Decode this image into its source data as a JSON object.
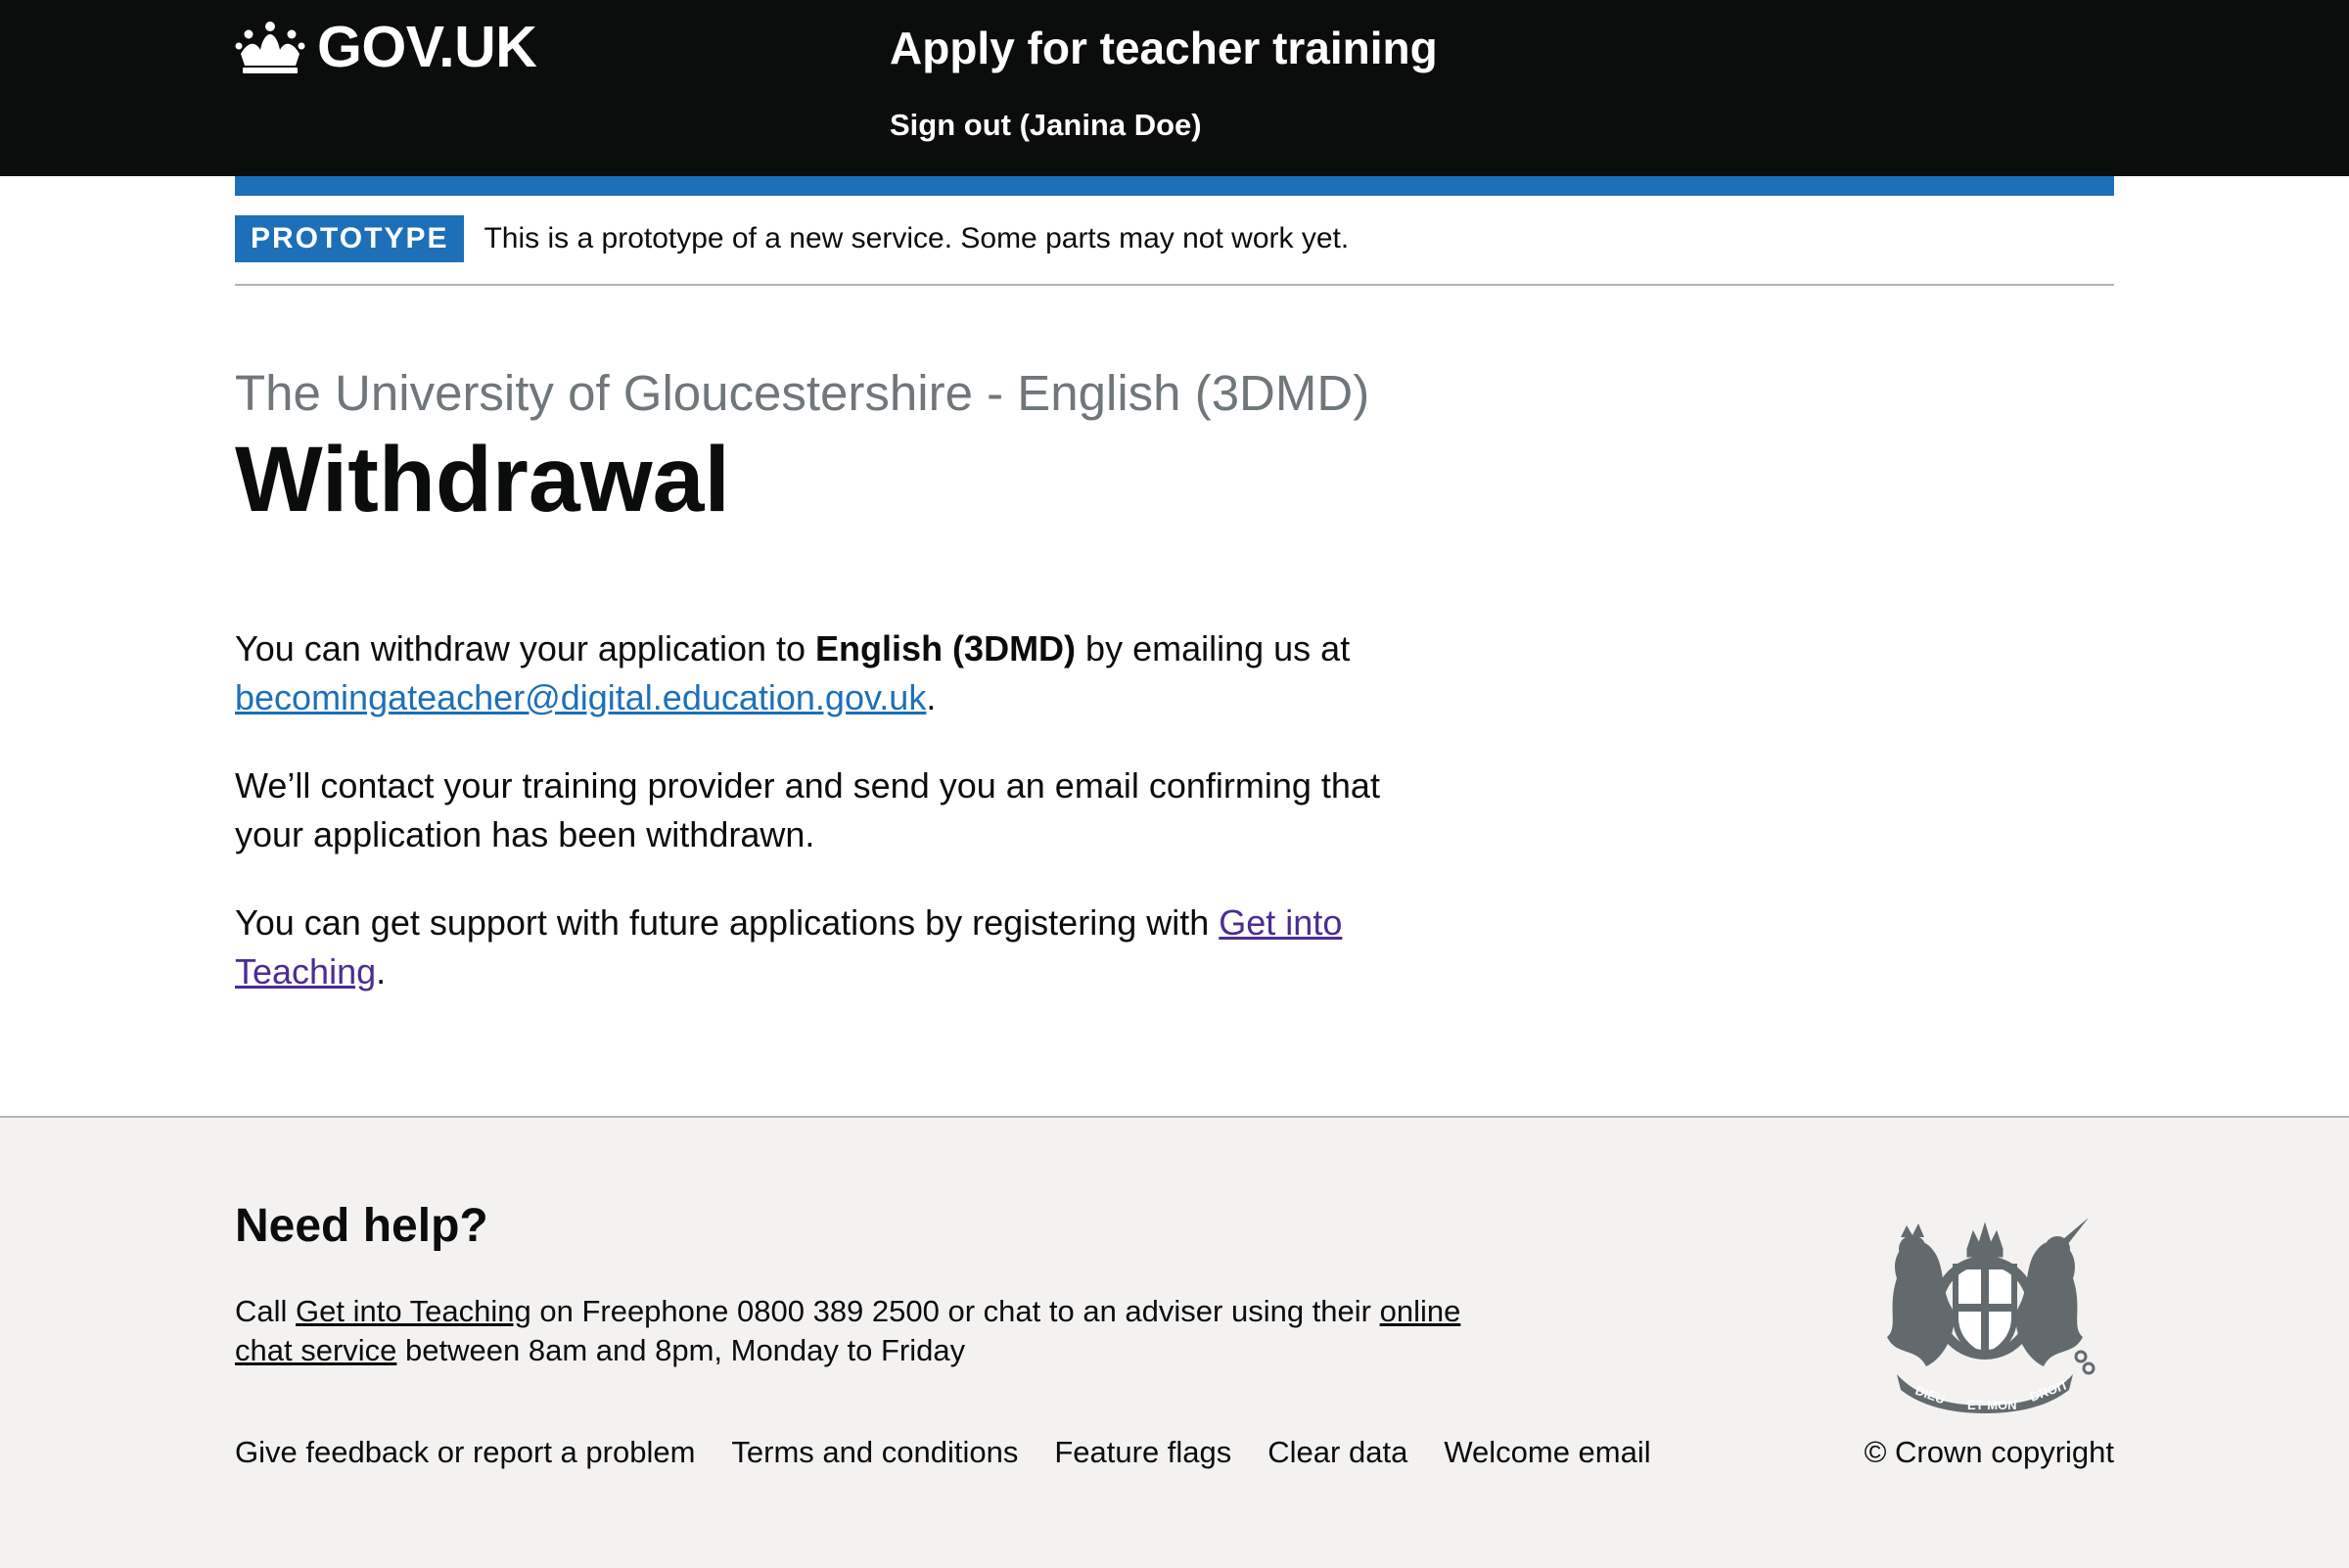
{
  "header": {
    "logo_text": "GOV.UK",
    "service_name": "Apply for teacher training",
    "sign_out": "Sign out (Janina Doe)"
  },
  "phase_banner": {
    "tag": "PROTOTYPE",
    "text": "This is a prototype of a new service. Some parts may not work yet."
  },
  "main": {
    "caption": "The University of Gloucestershire - English (3DMD)",
    "title": "Withdrawal",
    "p1_before": "You can withdraw your application to ",
    "p1_bold": "English (3DMD)",
    "p1_after": " by emailing us at ",
    "email": "becomingateacher@digital.education.gov.uk",
    "p1_end": ".",
    "p2": "We’ll contact your training provider and send you an email confirming that your application has been withdrawn.",
    "p3_before": "You can get support with future applications by registering with ",
    "p3_link": "Get into Teaching",
    "p3_end": "."
  },
  "footer": {
    "help_title": "Need help?",
    "help_call": "Call ",
    "help_link1": "Get into Teaching",
    "help_mid": " on Freephone 0800 389 2500 or chat to an adviser using their ",
    "help_link2": "online chat service",
    "help_end": " between 8am and 8pm, Monday to Friday",
    "links": [
      "Give feedback or report a problem",
      "Terms and conditions",
      "Feature flags",
      "Clear data",
      "Welcome email"
    ],
    "copyright": "© Crown copyright",
    "crest_text": [
      "DIEU",
      "ET MON",
      "DROIT"
    ]
  },
  "colors": {
    "header_bg": "#0b0c0c",
    "brand_blue": "#1d70b8",
    "visited_link": "#4c2c92",
    "footer_bg": "#f3f2f1",
    "caption_grey": "#6f777b"
  }
}
